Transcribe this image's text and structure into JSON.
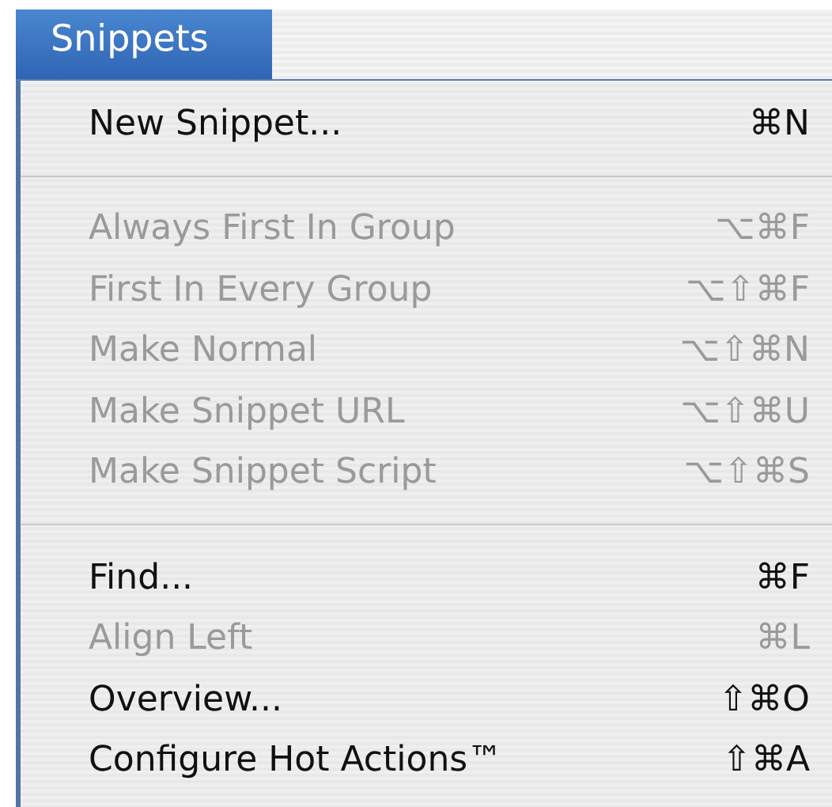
{
  "menu": {
    "title": "Snippets",
    "selected": true,
    "items": [
      {
        "kind": "item",
        "label": "New Snippet...",
        "shortcut": "⌘N",
        "disabled": false
      },
      {
        "kind": "separator"
      },
      {
        "kind": "item",
        "label": "Always First In Group",
        "shortcut": "⌥⌘F",
        "disabled": true
      },
      {
        "kind": "item",
        "label": "First In Every Group",
        "shortcut": "⌥⇧⌘F",
        "disabled": true
      },
      {
        "kind": "item",
        "label": "Make Normal",
        "shortcut": "⌥⇧⌘N",
        "disabled": true
      },
      {
        "kind": "item",
        "label": "Make Snippet URL",
        "shortcut": "⌥⇧⌘U",
        "disabled": true
      },
      {
        "kind": "item",
        "label": "Make Snippet Script",
        "shortcut": "⌥⇧⌘S",
        "disabled": true
      },
      {
        "kind": "separator"
      },
      {
        "kind": "item",
        "label": "Find...",
        "shortcut": "⌘F",
        "disabled": false
      },
      {
        "kind": "item",
        "label": "Align Left",
        "shortcut": "⌘L",
        "disabled": true
      },
      {
        "kind": "item",
        "label": "Overview...",
        "shortcut": "⇧⌘O",
        "disabled": false
      },
      {
        "kind": "item",
        "label": "Configure Hot Actions™",
        "shortcut": "⇧⌘A",
        "disabled": false
      }
    ]
  }
}
